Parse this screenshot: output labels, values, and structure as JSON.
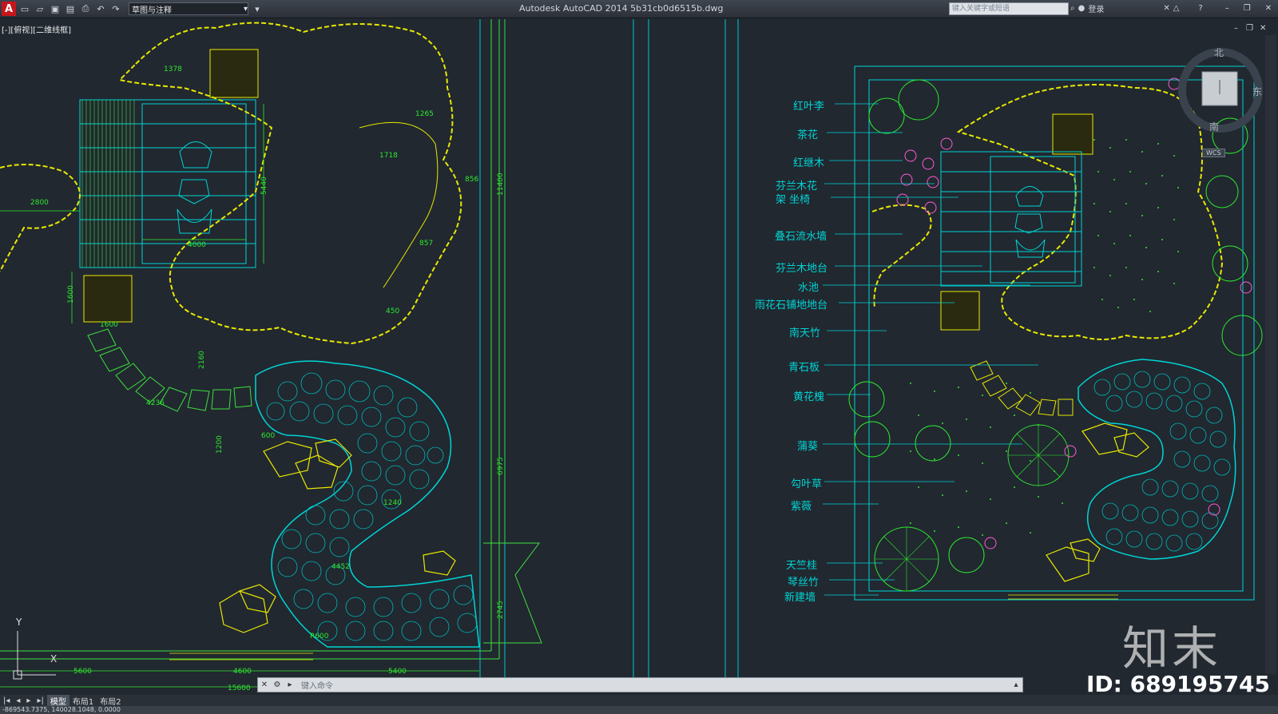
{
  "app": {
    "title": "Autodesk AutoCAD 2014    5b31cb0d6515b.dwg",
    "logo": "A",
    "workspace": "草图与注释",
    "search_placeholder": "键入关键字或短语",
    "login_label": "登录"
  },
  "viewport": {
    "label": "[-][俯视][二维线框]"
  },
  "command": {
    "placeholder": "键入命令"
  },
  "layout_tabs": [
    "模型",
    "布局1",
    "布局2"
  ],
  "status": {
    "coords": "-869543.7375, 140028.1048, 0.0000"
  },
  "plant_labels": [
    "红叶李",
    "茶花",
    "红继木",
    "芬兰木花",
    "架    坐椅",
    "叠石流水墙",
    "芬兰木地台",
    "水池",
    "雨花石铺地地台",
    "南天竹",
    "青石板",
    "黄花槐",
    "蒲葵",
    "勾叶草",
    "紫薇",
    "天竺桂",
    "琴丝竹",
    "新建墙"
  ],
  "dimensions": {
    "d2800": "2800",
    "d4000": "4000",
    "d5440": "5440",
    "d1600a": "1600",
    "d1600b": "1600",
    "d2160": "2160",
    "d1200": "1200",
    "d600": "600",
    "d5600": "5600",
    "d4600": "4600",
    "d5400": "5400",
    "d15600": "15600",
    "d11400": "11400",
    "d6975": "6975",
    "d2745": "2745",
    "d1378": "1378",
    "d1265": "1265",
    "d1718": "1718",
    "d856": "856",
    "d857": "857",
    "d450": "450",
    "dR600": "R600",
    "d4452": "4452",
    "d4236": "4236",
    "d1240": "1240"
  },
  "compass": {
    "north": "北",
    "east": "东",
    "south": "南",
    "wcs": "WCS"
  },
  "ucs": {
    "x": "X",
    "y": "Y"
  },
  "watermark": {
    "brand": "知末",
    "id": "ID: 689195745"
  },
  "colors": {
    "background": "#212830",
    "cyan": "#00d4d4",
    "yellow": "#e8e800",
    "green": "#2ee82e",
    "magenta": "#ff5ad2"
  }
}
